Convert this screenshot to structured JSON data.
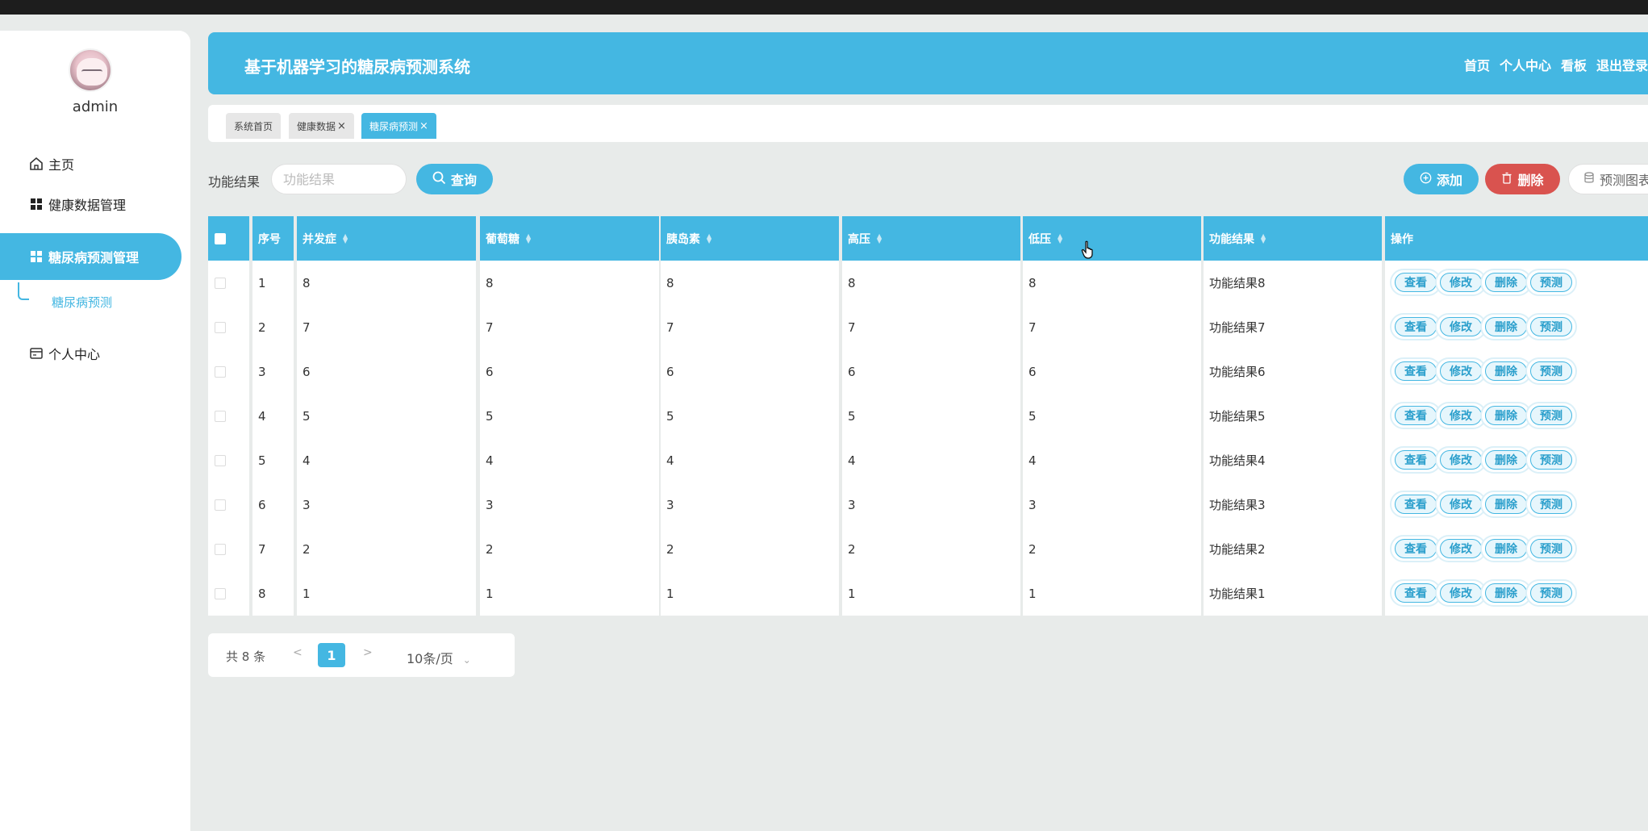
{
  "user": {
    "name": "admin"
  },
  "sidebar": {
    "items": [
      {
        "label": "主页",
        "icon": "home-icon"
      },
      {
        "label": "健康数据管理",
        "icon": "grid-icon"
      },
      {
        "label": "糖尿病预测管理",
        "icon": "grid-icon",
        "active": true
      },
      {
        "label": "个人中心",
        "icon": "card-icon"
      }
    ],
    "sub_item": "糖尿病预测"
  },
  "header": {
    "title": "基于机器学习的糖尿病预测系统",
    "links": [
      "首页",
      "个人中心",
      "看板",
      "退出登录"
    ]
  },
  "tabs": [
    {
      "label": "系统首页",
      "closable": false
    },
    {
      "label": "健康数据",
      "closable": true
    },
    {
      "label": "糖尿病预测",
      "closable": true,
      "active": true
    }
  ],
  "search": {
    "label": "功能结果",
    "placeholder": "功能结果",
    "query_label": "查询",
    "add_label": "添加",
    "delete_label": "删除",
    "chart_label": "预测图表"
  },
  "table": {
    "columns": [
      "序号",
      "并发症",
      "葡萄糖",
      "胰岛素",
      "高压",
      "低压",
      "功能结果",
      "操作"
    ],
    "rows": [
      [
        "1",
        "8",
        "8",
        "8",
        "8",
        "8",
        "功能结果8"
      ],
      [
        "2",
        "7",
        "7",
        "7",
        "7",
        "7",
        "功能结果7"
      ],
      [
        "3",
        "6",
        "6",
        "6",
        "6",
        "6",
        "功能结果6"
      ],
      [
        "4",
        "5",
        "5",
        "5",
        "5",
        "5",
        "功能结果5"
      ],
      [
        "5",
        "4",
        "4",
        "4",
        "4",
        "4",
        "功能结果4"
      ],
      [
        "6",
        "3",
        "3",
        "3",
        "3",
        "3",
        "功能结果3"
      ],
      [
        "7",
        "2",
        "2",
        "2",
        "2",
        "2",
        "功能结果2"
      ],
      [
        "8",
        "1",
        "1",
        "1",
        "1",
        "1",
        "功能结果1"
      ]
    ],
    "actions": [
      "查看",
      "修改",
      "删除",
      "预测"
    ]
  },
  "pagination": {
    "total": "共 8 条",
    "prev": "<",
    "next": ">",
    "current": "1",
    "page_size": "10条/页"
  },
  "colors": {
    "accent": "#44b7e2",
    "danger": "#d9534f"
  }
}
